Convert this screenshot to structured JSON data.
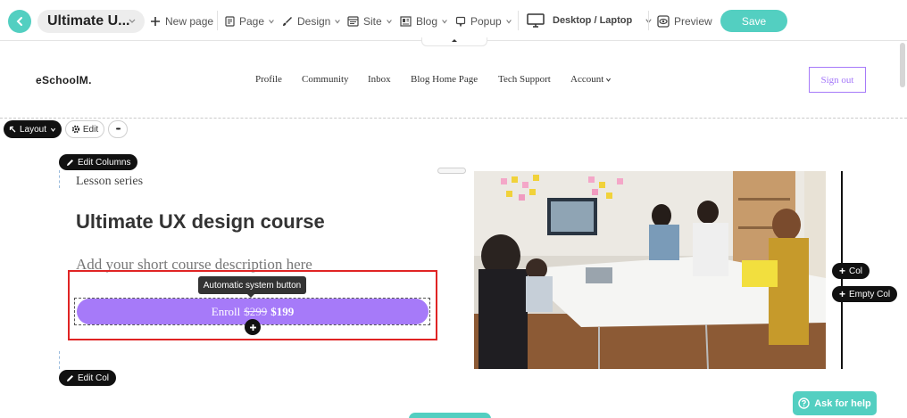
{
  "toolbar": {
    "page_name": "Ultimate U...",
    "new_page": "New page",
    "page": "Page",
    "design": "Design",
    "site": "Site",
    "blog": "Blog",
    "popup": "Popup",
    "device": "Desktop / Laptop",
    "preview": "Preview",
    "save": "Save"
  },
  "site": {
    "logo": "eSchoolM.",
    "nav": [
      "Profile",
      "Community",
      "Inbox",
      "Blog Home Page",
      "Tech Support",
      "Account"
    ],
    "sign_out": "Sign out"
  },
  "builder": {
    "layout": "Layout",
    "edit": "Edit",
    "more": "•••",
    "edit_columns": "Edit Columns",
    "edit_col": "Edit Col",
    "add_col": "Col",
    "add_empty_col": "Empty Col",
    "tooltip": "Automatic system button",
    "help": "Ask for help"
  },
  "content": {
    "lesson_series": "Lesson series",
    "title": "Ultimate UX design course",
    "description": "Add your short course description here",
    "enroll_label": "Enroll",
    "old_price": "$299",
    "new_price": "$199"
  },
  "colors": {
    "accent": "#53cfc1",
    "button_purple": "#a67af9",
    "selection_red": "#e02424"
  }
}
